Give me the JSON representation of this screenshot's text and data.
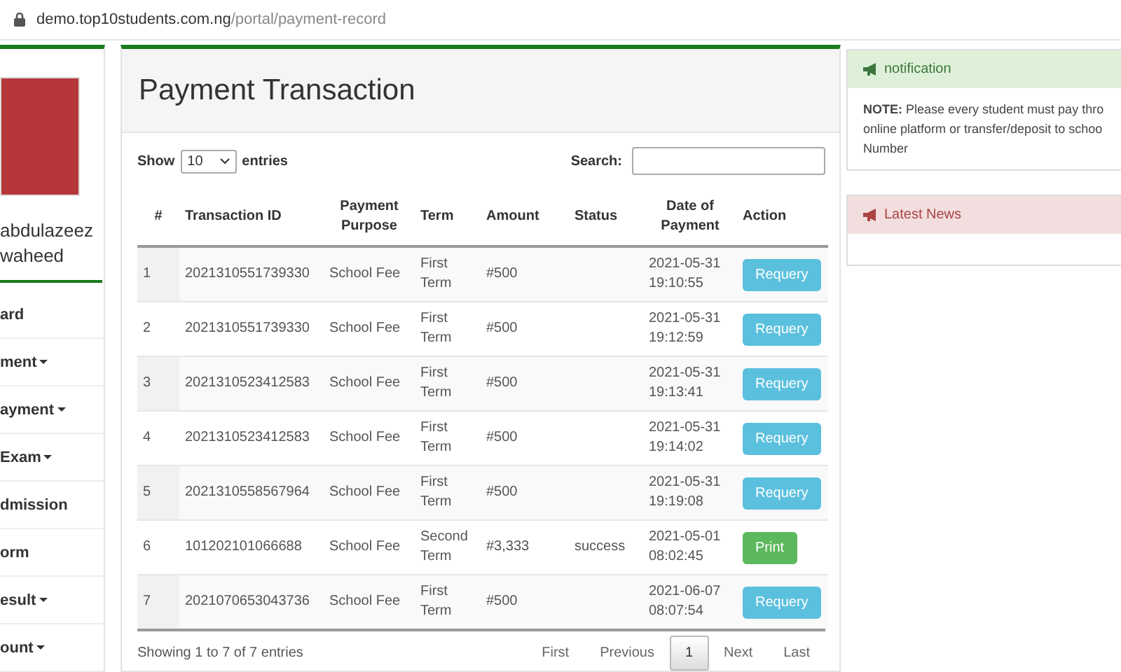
{
  "address_bar": {
    "host": "demo.top10students.com.ng",
    "path": "/portal/payment-record"
  },
  "sidebar": {
    "name_lines": [
      "abdulazeez",
      "waheed"
    ],
    "items": [
      {
        "label": "ard",
        "dropdown": false
      },
      {
        "label": "ment",
        "dropdown": true
      },
      {
        "label": "ayment",
        "dropdown": true
      },
      {
        "label": "Exam",
        "dropdown": true
      },
      {
        "label": "dmission",
        "dropdown": false
      },
      {
        "label": "orm",
        "dropdown": false
      },
      {
        "label": "esult",
        "dropdown": true
      },
      {
        "label": "ount",
        "dropdown": true
      }
    ]
  },
  "main": {
    "title": "Payment Transaction",
    "show_label": "Show",
    "page_size": "10",
    "entries_label": "entries",
    "search_label": "Search:",
    "table": {
      "columns": [
        "#",
        "Transaction ID",
        "Payment Purpose",
        "Term",
        "Amount",
        "Status",
        "Date of Payment",
        "Action"
      ],
      "rows": [
        {
          "n": "1",
          "id": "2021310551739330",
          "purpose": "School Fee",
          "term": "First Term",
          "amount": "#500",
          "status": "",
          "date": "2021-05-31 19:10:55",
          "action": {
            "kind": "requery",
            "label": "Requery"
          }
        },
        {
          "n": "2",
          "id": "2021310551739330",
          "purpose": "School Fee",
          "term": "First Term",
          "amount": "#500",
          "status": "",
          "date": "2021-05-31 19:12:59",
          "action": {
            "kind": "requery",
            "label": "Requery"
          }
        },
        {
          "n": "3",
          "id": "2021310523412583",
          "purpose": "School Fee",
          "term": "First Term",
          "amount": "#500",
          "status": "",
          "date": "2021-05-31 19:13:41",
          "action": {
            "kind": "requery",
            "label": "Requery"
          }
        },
        {
          "n": "4",
          "id": "2021310523412583",
          "purpose": "School Fee",
          "term": "First Term",
          "amount": "#500",
          "status": "",
          "date": "2021-05-31 19:14:02",
          "action": {
            "kind": "requery",
            "label": "Requery"
          }
        },
        {
          "n": "5",
          "id": "2021310558567964",
          "purpose": "School Fee",
          "term": "First Term",
          "amount": "#500",
          "status": "",
          "date": "2021-05-31 19:19:08",
          "action": {
            "kind": "requery",
            "label": "Requery"
          }
        },
        {
          "n": "6",
          "id": "101202101066688",
          "purpose": "School Fee",
          "term": "Second Term",
          "amount": "#3,333",
          "status": "success",
          "date": "2021-05-01 08:02:45",
          "action": {
            "kind": "print",
            "label": "Print"
          }
        },
        {
          "n": "7",
          "id": "2021070653043736",
          "purpose": "School Fee",
          "term": "First Term",
          "amount": "#500",
          "status": "",
          "date": "2021-06-07 08:07:54",
          "action": {
            "kind": "requery",
            "label": "Requery"
          }
        }
      ]
    },
    "info": "Showing 1 to 7 of 7 entries",
    "pagination": [
      {
        "label": "First",
        "selected": false
      },
      {
        "label": "Previous",
        "selected": false
      },
      {
        "label": "1",
        "selected": true
      },
      {
        "label": "Next",
        "selected": false
      },
      {
        "label": "Last",
        "selected": false
      }
    ]
  },
  "panels": [
    {
      "kind": "success",
      "title": "notification",
      "lines": [
        "**NOTE:** Please every student must pay thro",
        "online platform or transfer/deposit to schoo",
        "Number"
      ]
    },
    {
      "kind": "danger",
      "title": "Latest News"
    }
  ]
}
